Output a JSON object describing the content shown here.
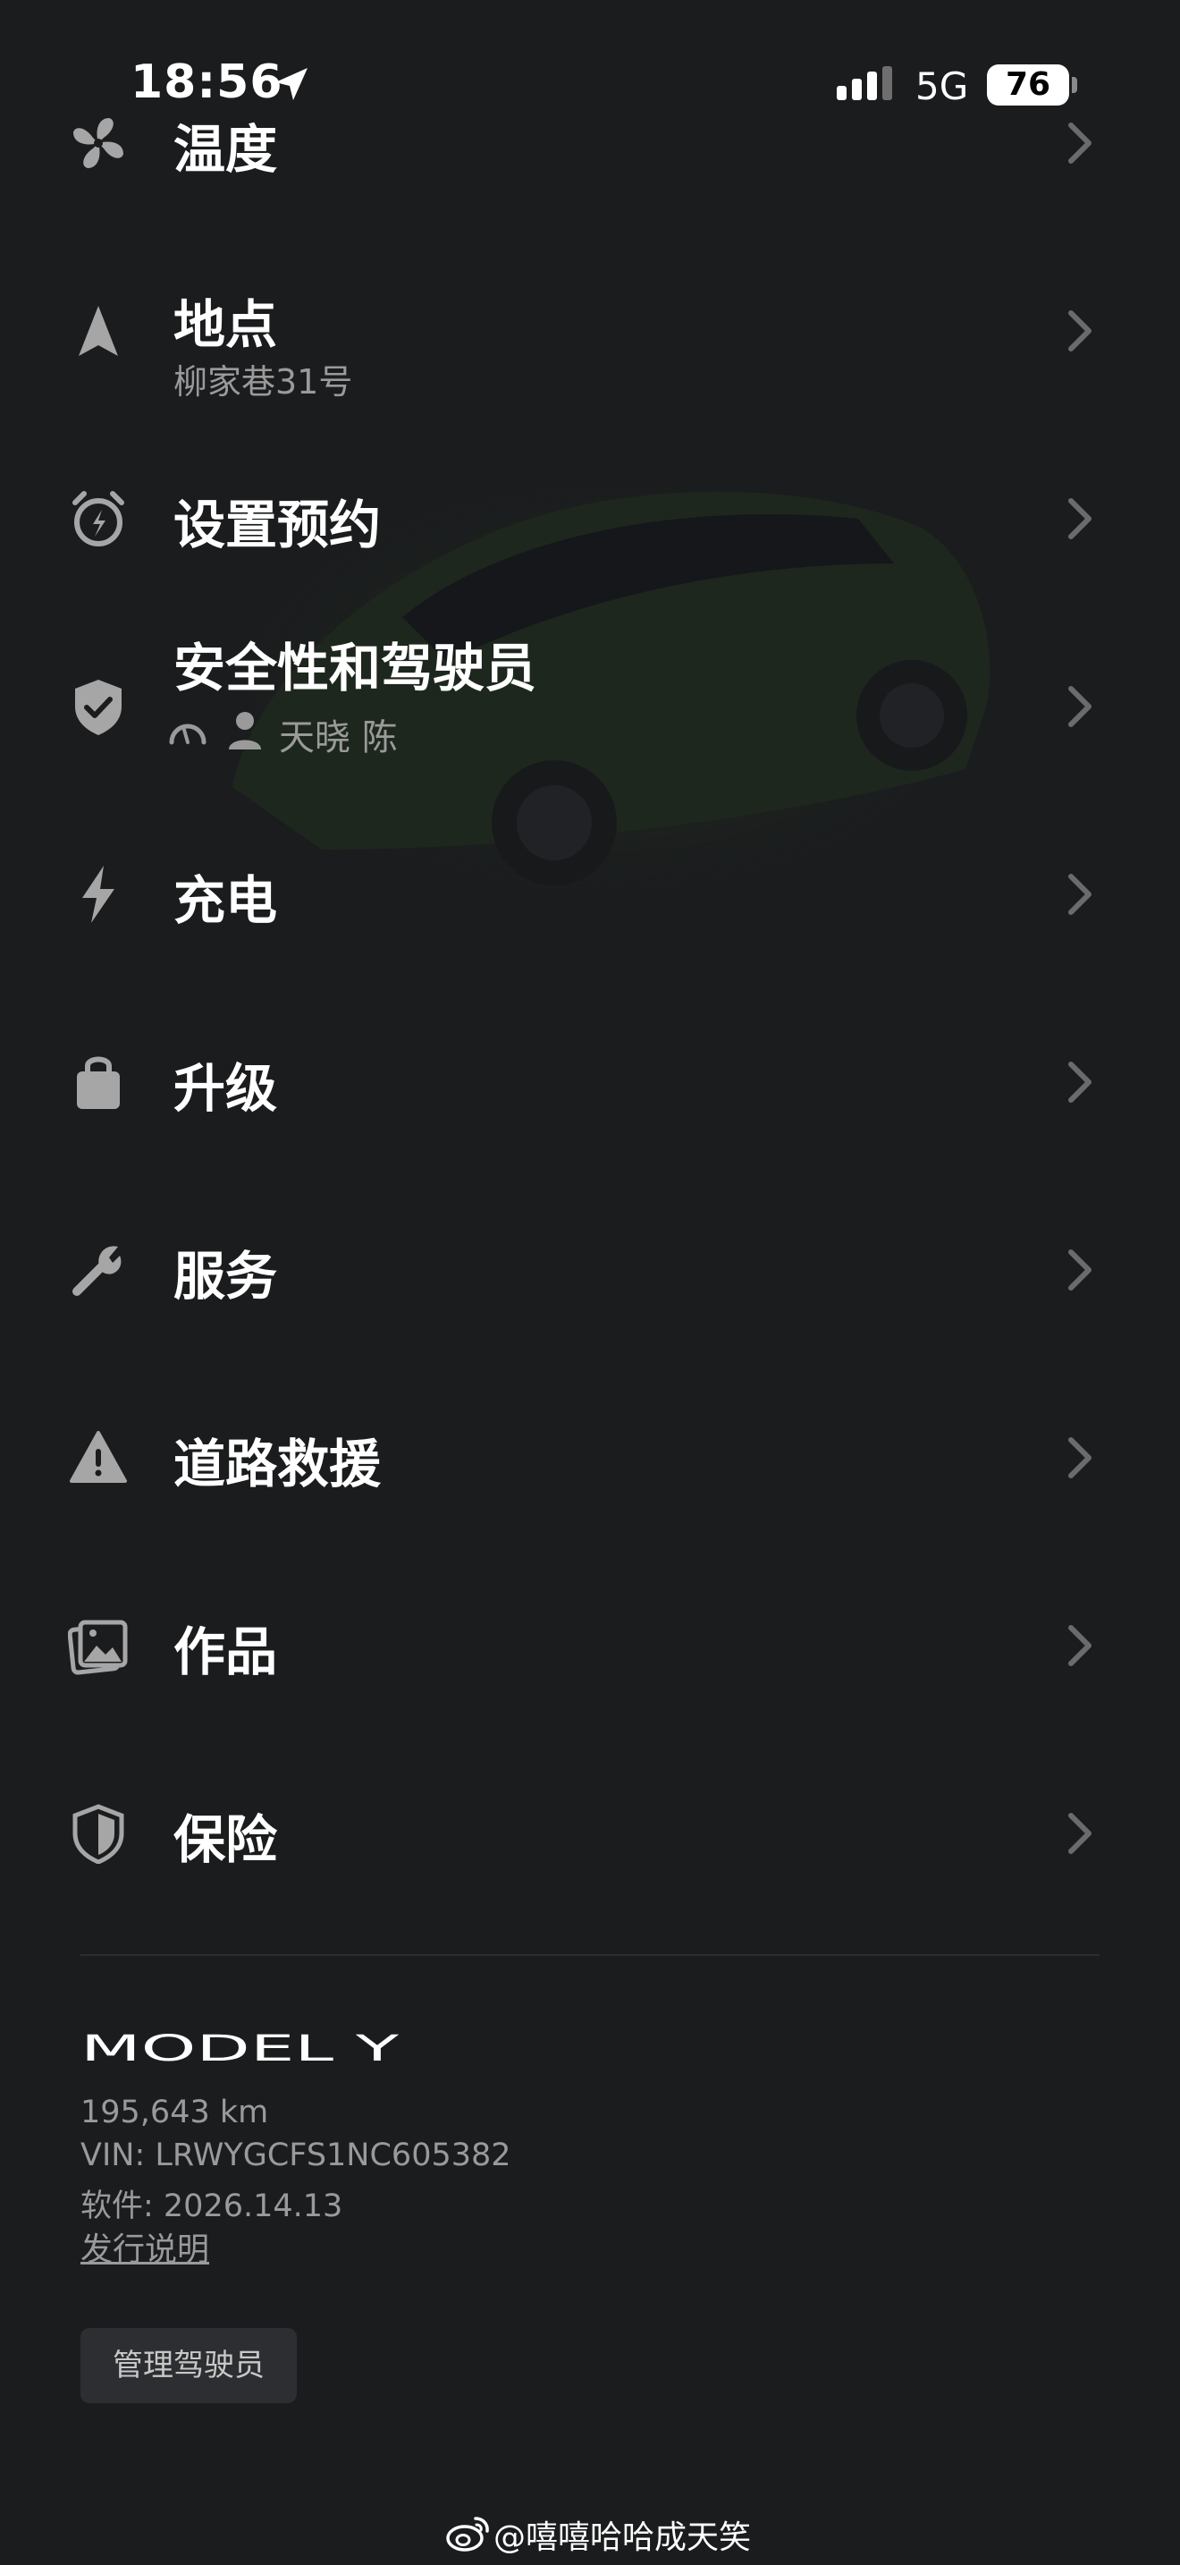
{
  "status_bar": {
    "time": "18:56",
    "network": "5G",
    "battery": "76",
    "icons": [
      "location-arrow-icon",
      "signal-bars-icon"
    ]
  },
  "menu": {
    "items": [
      {
        "title": "温度",
        "icon": "fan-icon"
      },
      {
        "title": "地点",
        "subtitle": "柳家巷31号",
        "icon": "navigation-arrow-icon"
      },
      {
        "title": "设置预约",
        "icon": "alarm-clock-icon"
      },
      {
        "title": "安全性和驾驶员",
        "driver": "天晓 陈",
        "icon": "shield-check-icon"
      },
      {
        "title": "充电",
        "icon": "lightning-icon"
      },
      {
        "title": "升级",
        "icon": "shopping-bag-icon"
      },
      {
        "title": "服务",
        "icon": "wrench-icon"
      },
      {
        "title": "道路救援",
        "icon": "warning-triangle-icon"
      },
      {
        "title": "作品",
        "icon": "gallery-icon"
      },
      {
        "title": "保险",
        "icon": "shield-icon"
      }
    ]
  },
  "vehicle": {
    "model": "MODEL Y",
    "odometer": "195,643 km",
    "vin": "VIN: LRWYGCFS1NC605382",
    "software": "软件: 2026.14.13",
    "release_notes": "发行说明",
    "manage_drivers": "管理驾驶员"
  },
  "watermark": "@嘻嘻哈哈成天笑",
  "colors": {
    "background": "#1b1c1e",
    "text_primary": "#ffffff",
    "text_secondary": "#9a9a9a",
    "icon": "#a6a6a6",
    "chevron": "#6b6b6b",
    "car_accent": "#2e5a1f"
  }
}
